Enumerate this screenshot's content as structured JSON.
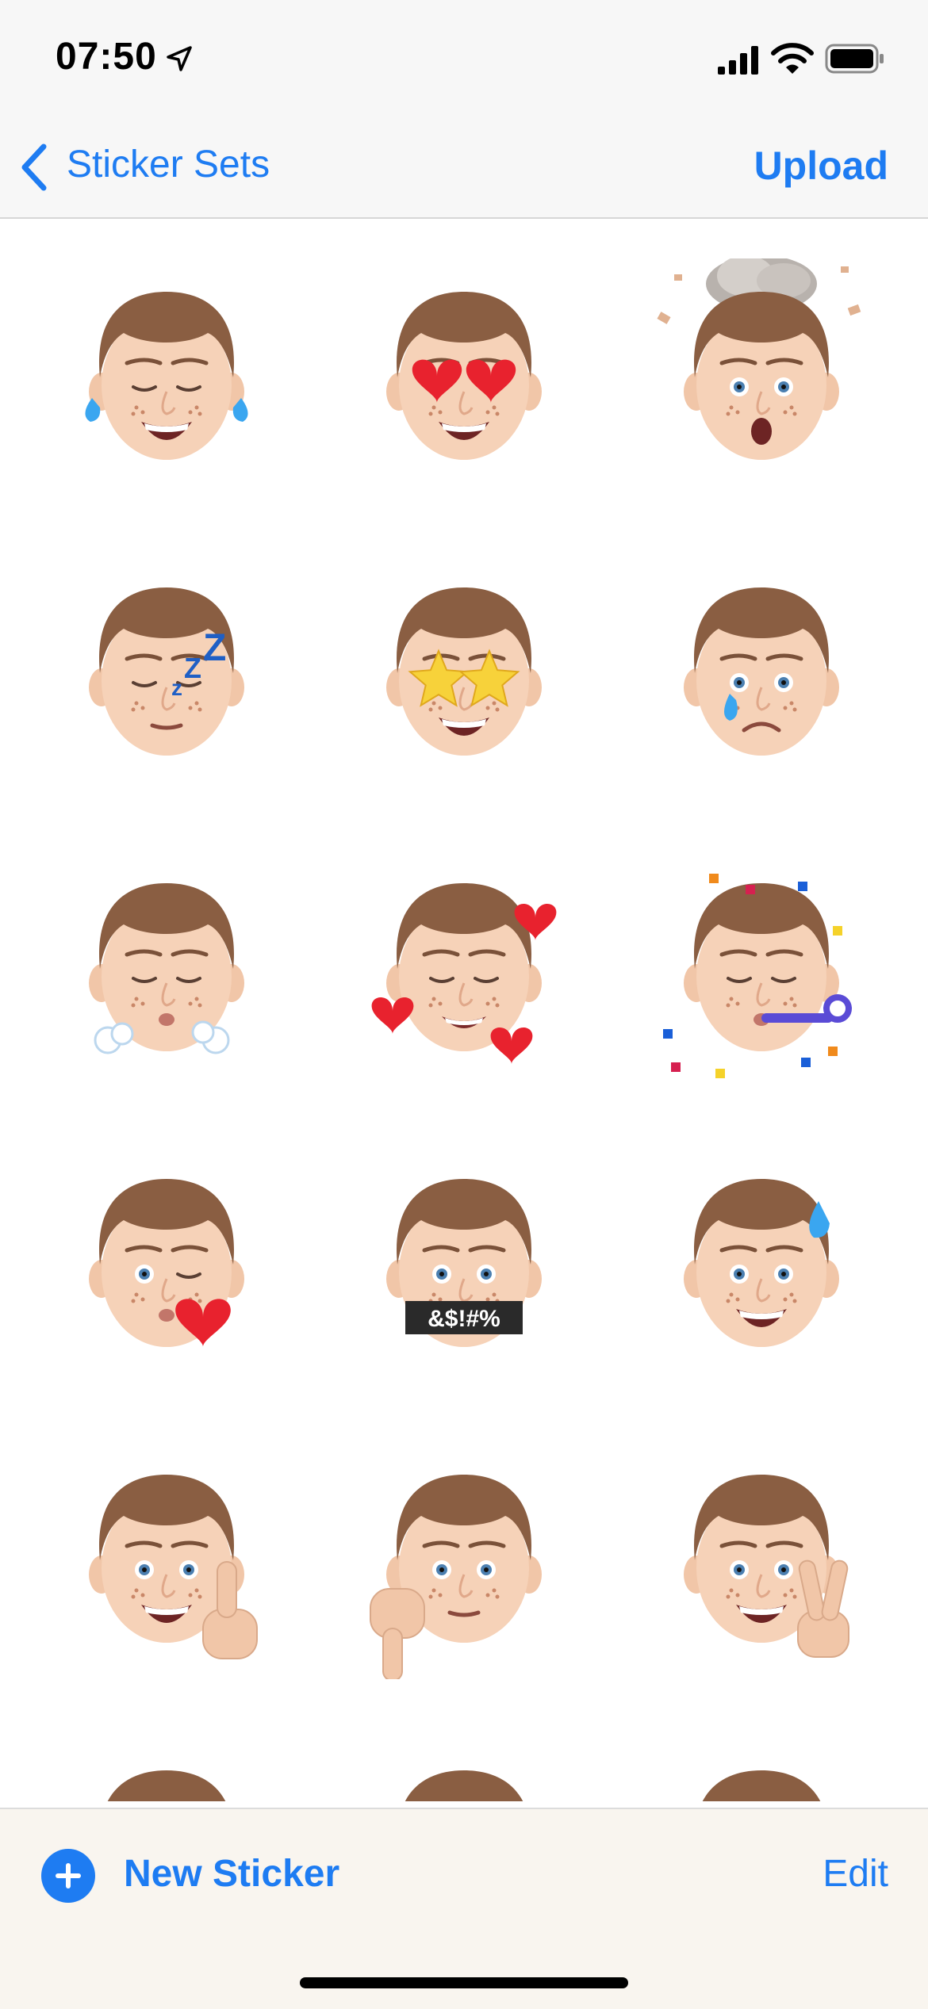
{
  "status_bar": {
    "time": "07:50"
  },
  "nav": {
    "back_label": "Sticker Sets",
    "action_label": "Upload"
  },
  "colors": {
    "accent": "#1e7cf2",
    "bar_background": "#f7f7f7",
    "toolbar_background": "#f9f5ef"
  },
  "stickers": [
    {
      "name": "tears-of-joy-sticker",
      "accessory": "tears"
    },
    {
      "name": "heart-eyes-sticker",
      "accessory": "heart-eyes"
    },
    {
      "name": "mind-blown-sticker",
      "accessory": "explosion"
    },
    {
      "name": "sleeping-sticker",
      "accessory": "zzz"
    },
    {
      "name": "star-struck-sticker",
      "accessory": "star-eyes"
    },
    {
      "name": "sad-tear-sticker",
      "accessory": "tear"
    },
    {
      "name": "huffing-sticker",
      "accessory": "steam"
    },
    {
      "name": "smiling-hearts-sticker",
      "accessory": "hearts"
    },
    {
      "name": "party-sticker",
      "accessory": "party"
    },
    {
      "name": "kiss-wink-sticker",
      "accessory": "kiss-heart"
    },
    {
      "name": "cursing-sticker",
      "accessory": "symbols",
      "text": "&$!#%"
    },
    {
      "name": "sweat-smile-sticker",
      "accessory": "sweat"
    },
    {
      "name": "thumbs-up-sticker",
      "accessory": "thumbs-up"
    },
    {
      "name": "thumbs-down-sticker",
      "accessory": "thumbs-down"
    },
    {
      "name": "peace-sign-sticker",
      "accessory": "peace"
    },
    {
      "name": "partial-sticker-1",
      "accessory": "none"
    },
    {
      "name": "partial-sticker-2",
      "accessory": "none"
    },
    {
      "name": "partial-sticker-3",
      "accessory": "none"
    }
  ],
  "toolbar": {
    "new_label": "New Sticker",
    "edit_label": "Edit"
  }
}
